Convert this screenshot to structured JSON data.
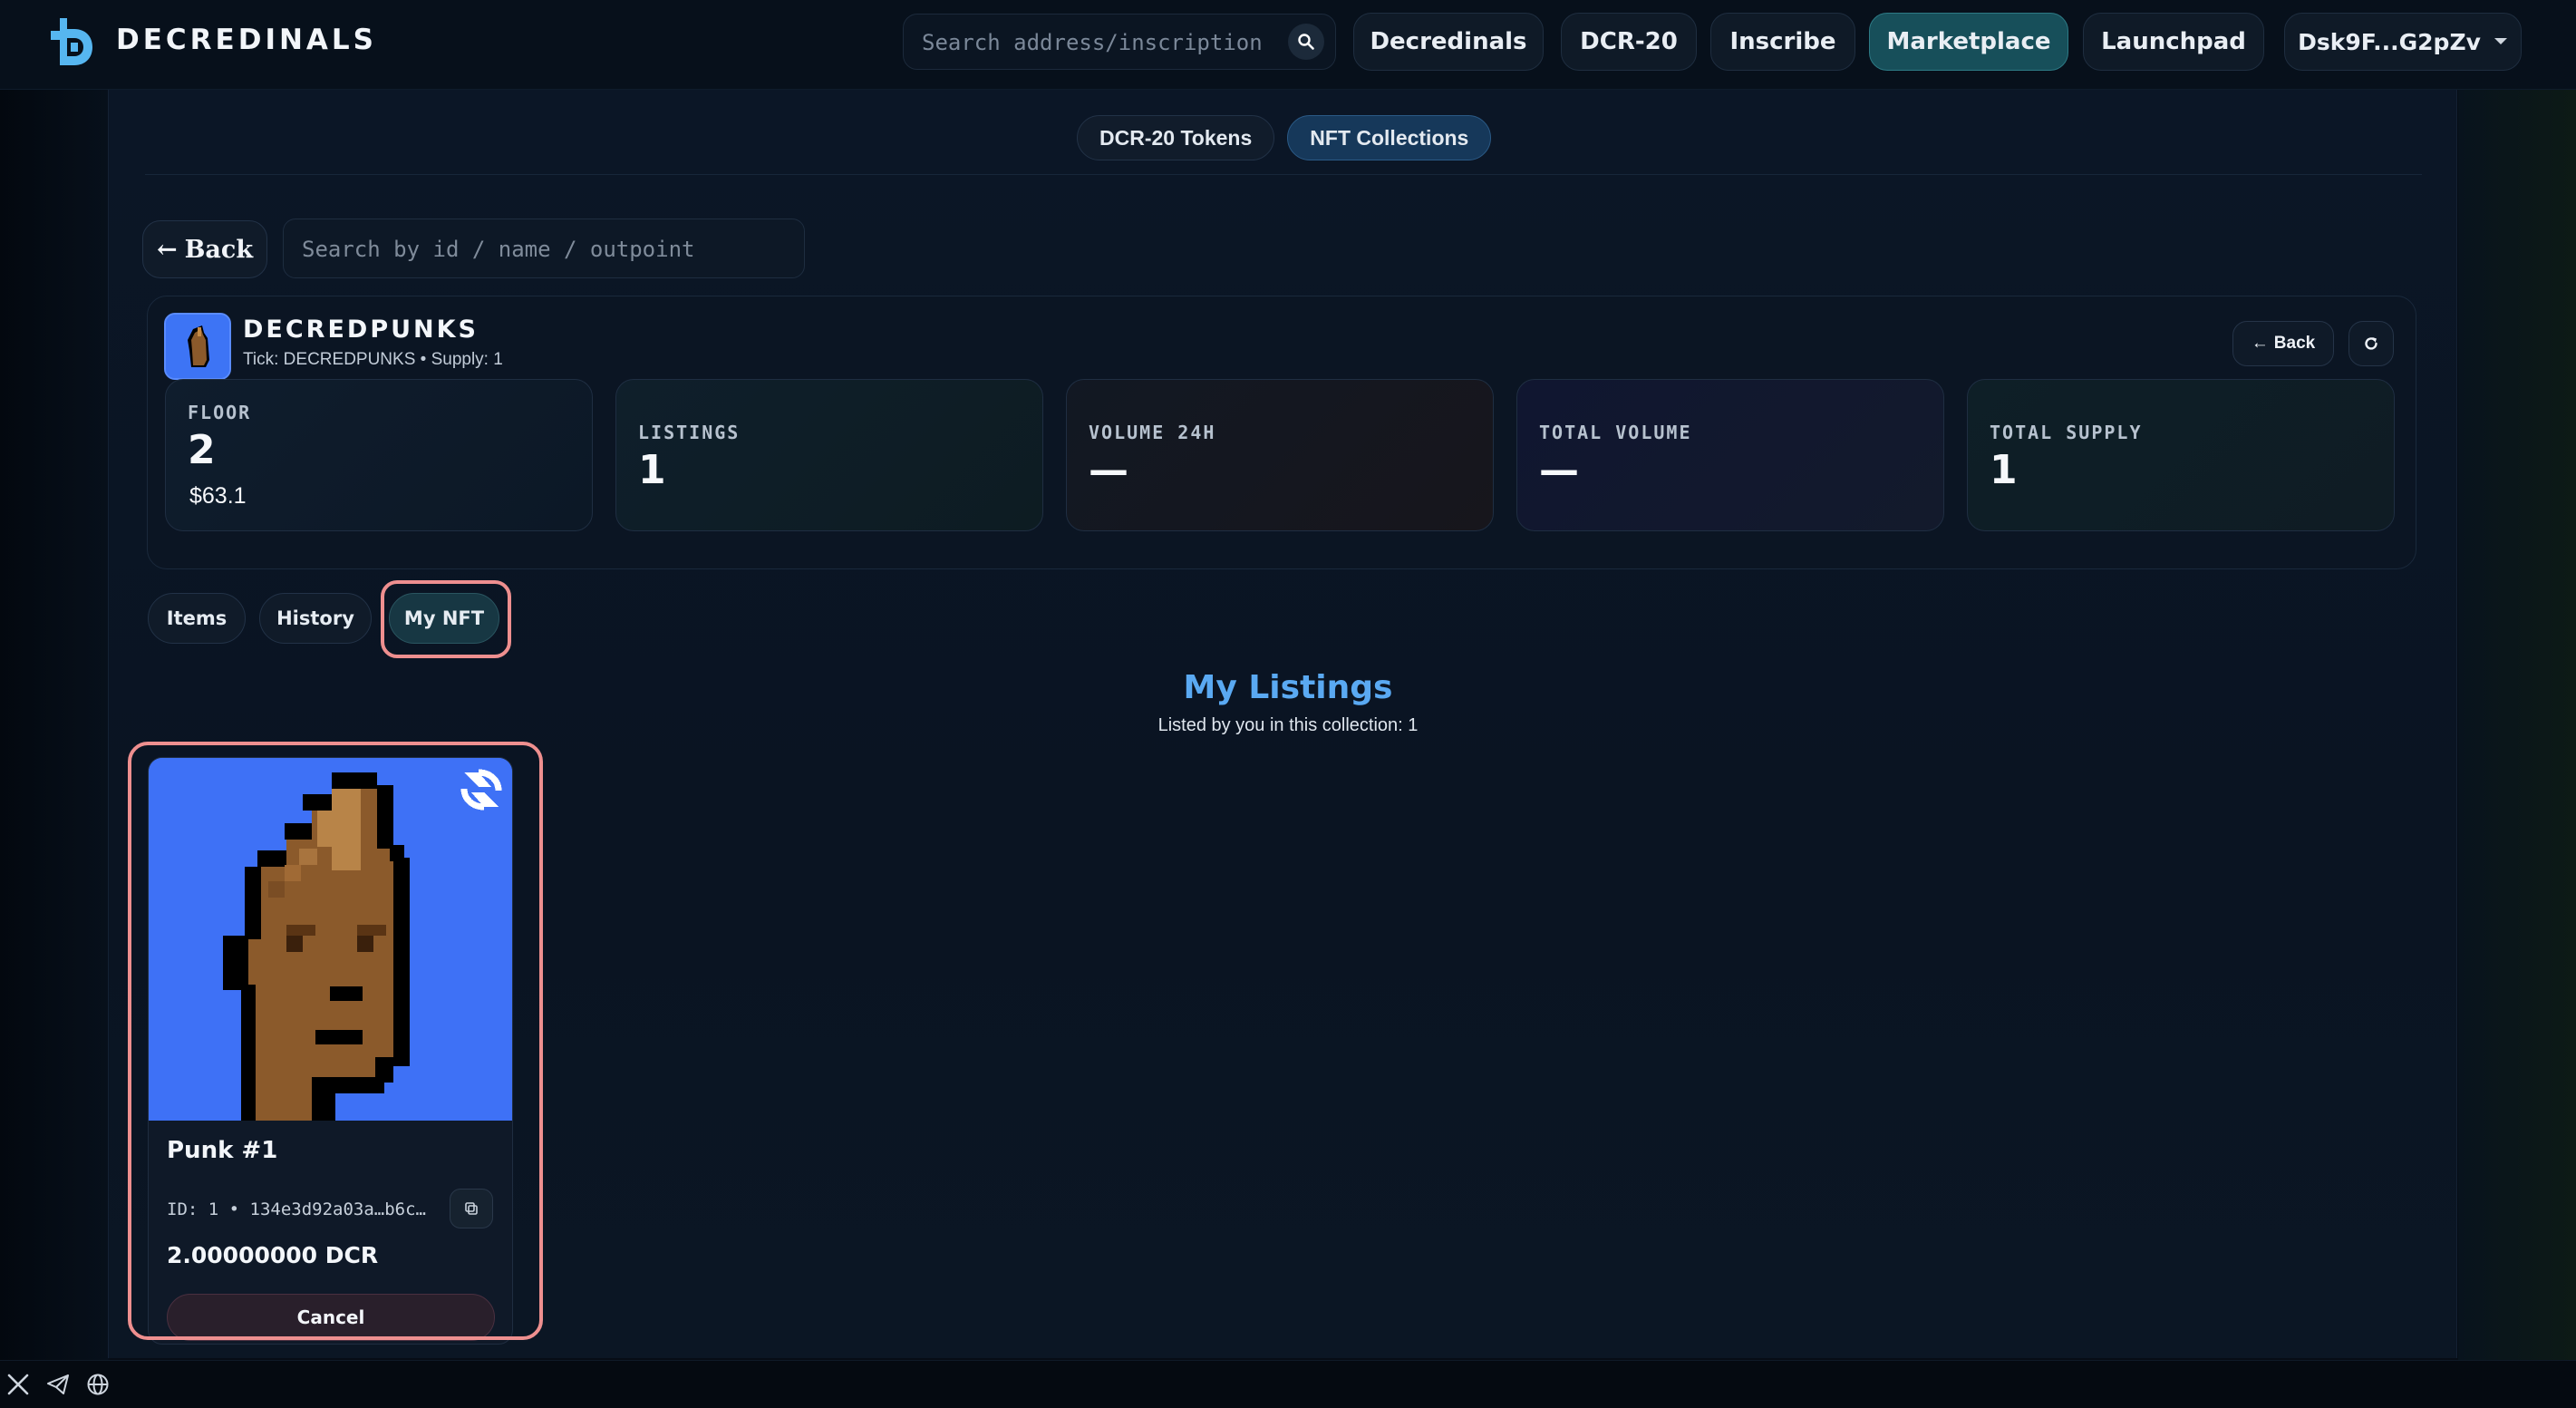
{
  "brand": {
    "name": "DECREDINALS"
  },
  "header": {
    "search_placeholder": "Search address/inscription",
    "nav": [
      "Decredinals",
      "DCR-20",
      "Inscribe",
      "Marketplace",
      "Launchpad"
    ],
    "active_nav": "Marketplace",
    "wallet": "Dsk9F...G2pZv"
  },
  "market_tabs": [
    "DCR-20 Tokens",
    "NFT Collections"
  ],
  "active_market_tab": "NFT Collections",
  "toolbar": {
    "back_label": "Back",
    "search_placeholder": "Search by id / name / outpoint"
  },
  "collection": {
    "name": "DECREDPUNKS",
    "subtitle": "Tick: DECREDPUNKS • Supply: 1",
    "back_label": "Back",
    "stats": {
      "floor": {
        "label": "FLOOR",
        "value": "2",
        "usd": "$63.1"
      },
      "listings": {
        "label": "LISTINGS",
        "value": "1"
      },
      "volume_24h": {
        "label": "VOLUME 24H",
        "value": "—"
      },
      "total_volume": {
        "label": "TOTAL VOLUME",
        "value": "—"
      },
      "total_supply": {
        "label": "TOTAL SUPPLY",
        "value": "1"
      }
    }
  },
  "view_tabs": [
    "Items",
    "History",
    "My NFT"
  ],
  "active_view_tab": "My NFT",
  "listings_section": {
    "title": "My Listings",
    "subtitle": "Listed by you in this collection: 1"
  },
  "nft": {
    "name": "Punk #1",
    "id_line": "ID: 1 • 134e3d92a03a…b6c…",
    "price": "2.00000000 DCR",
    "cancel_label": "Cancel"
  },
  "footer": {
    "icons": [
      "x-icon",
      "telegram-icon",
      "globe-icon"
    ]
  },
  "colors": {
    "accent_teal": "#174f5a",
    "title_blue": "#5aa9f2",
    "highlight": "#ee8f8f",
    "nft_background": "#3e71f6"
  }
}
